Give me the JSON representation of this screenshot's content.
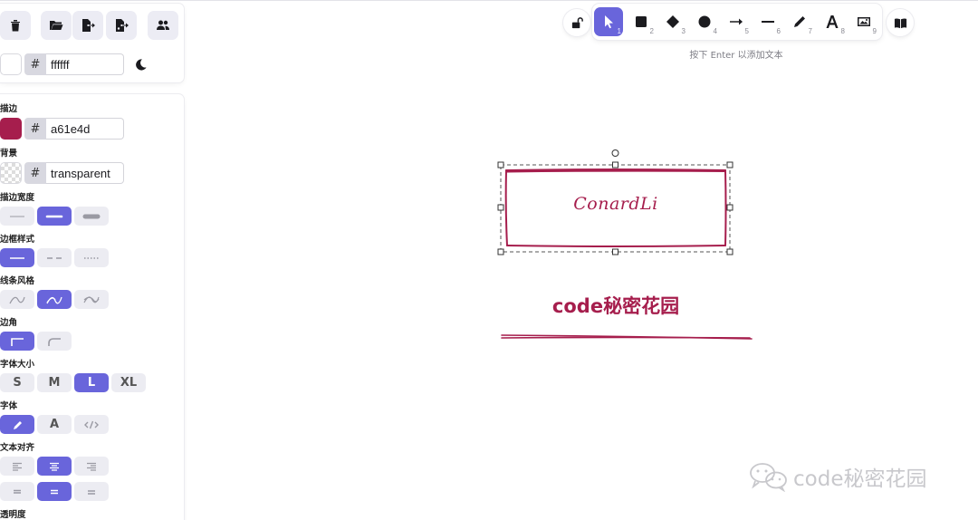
{
  "top_panel": {
    "actions": [
      {
        "name": "clear-canvas-button",
        "icon": "trash-icon"
      },
      {
        "name": "open-button",
        "icon": "folder-open-icon"
      },
      {
        "name": "save-button",
        "icon": "file-export-icon"
      },
      {
        "name": "export-image-button",
        "icon": "file-image-export-icon"
      },
      {
        "name": "collaborate-button",
        "icon": "users-icon"
      }
    ],
    "canvas_bg_hex": "ffffff",
    "hash": "#",
    "theme_toggle_icon": "moon-icon"
  },
  "props": {
    "stroke_label": "描边",
    "stroke_hex": "a61e4d",
    "stroke_color": "#a61e4d",
    "background_label": "背景",
    "background_hex": "transparent",
    "stroke_width_label": "描边宽度",
    "stroke_style_label": "边框样式",
    "sloppiness_label": "线条风格",
    "edges_label": "边角",
    "font_size_label": "字体大小",
    "font_sizes": [
      "S",
      "M",
      "L",
      "XL"
    ],
    "font_family_label": "字体",
    "font_family_text": "A",
    "text_align_label": "文本对齐",
    "opacity_label": "透明度"
  },
  "toolbar": {
    "lock_icon": "lock-open-icon",
    "tools": [
      {
        "name": "select",
        "icon": "pointer-icon",
        "num": "1",
        "active": true
      },
      {
        "name": "rectangle",
        "icon": "square-icon",
        "num": "2"
      },
      {
        "name": "diamond",
        "icon": "diamond-icon",
        "num": "3"
      },
      {
        "name": "ellipse",
        "icon": "circle-icon",
        "num": "4"
      },
      {
        "name": "arrow",
        "icon": "arrow-right-icon",
        "num": "5"
      },
      {
        "name": "line",
        "icon": "line-icon",
        "num": "6"
      },
      {
        "name": "draw",
        "icon": "pencil-icon",
        "num": "7"
      },
      {
        "name": "text",
        "icon": "text-icon",
        "num": "8"
      },
      {
        "name": "image",
        "icon": "image-icon",
        "num": "9"
      }
    ],
    "library_icon": "book-icon",
    "hint": "按下 Enter 以添加文本"
  },
  "canvas": {
    "box_text": "ConardLi",
    "title_text": "code秘密花园",
    "accent": "#a61e4d"
  },
  "watermark": {
    "text": "code秘密花园",
    "icon": "wechat-icon"
  },
  "colors": {
    "primary": "#6965db",
    "button_bg": "#ececf4"
  }
}
